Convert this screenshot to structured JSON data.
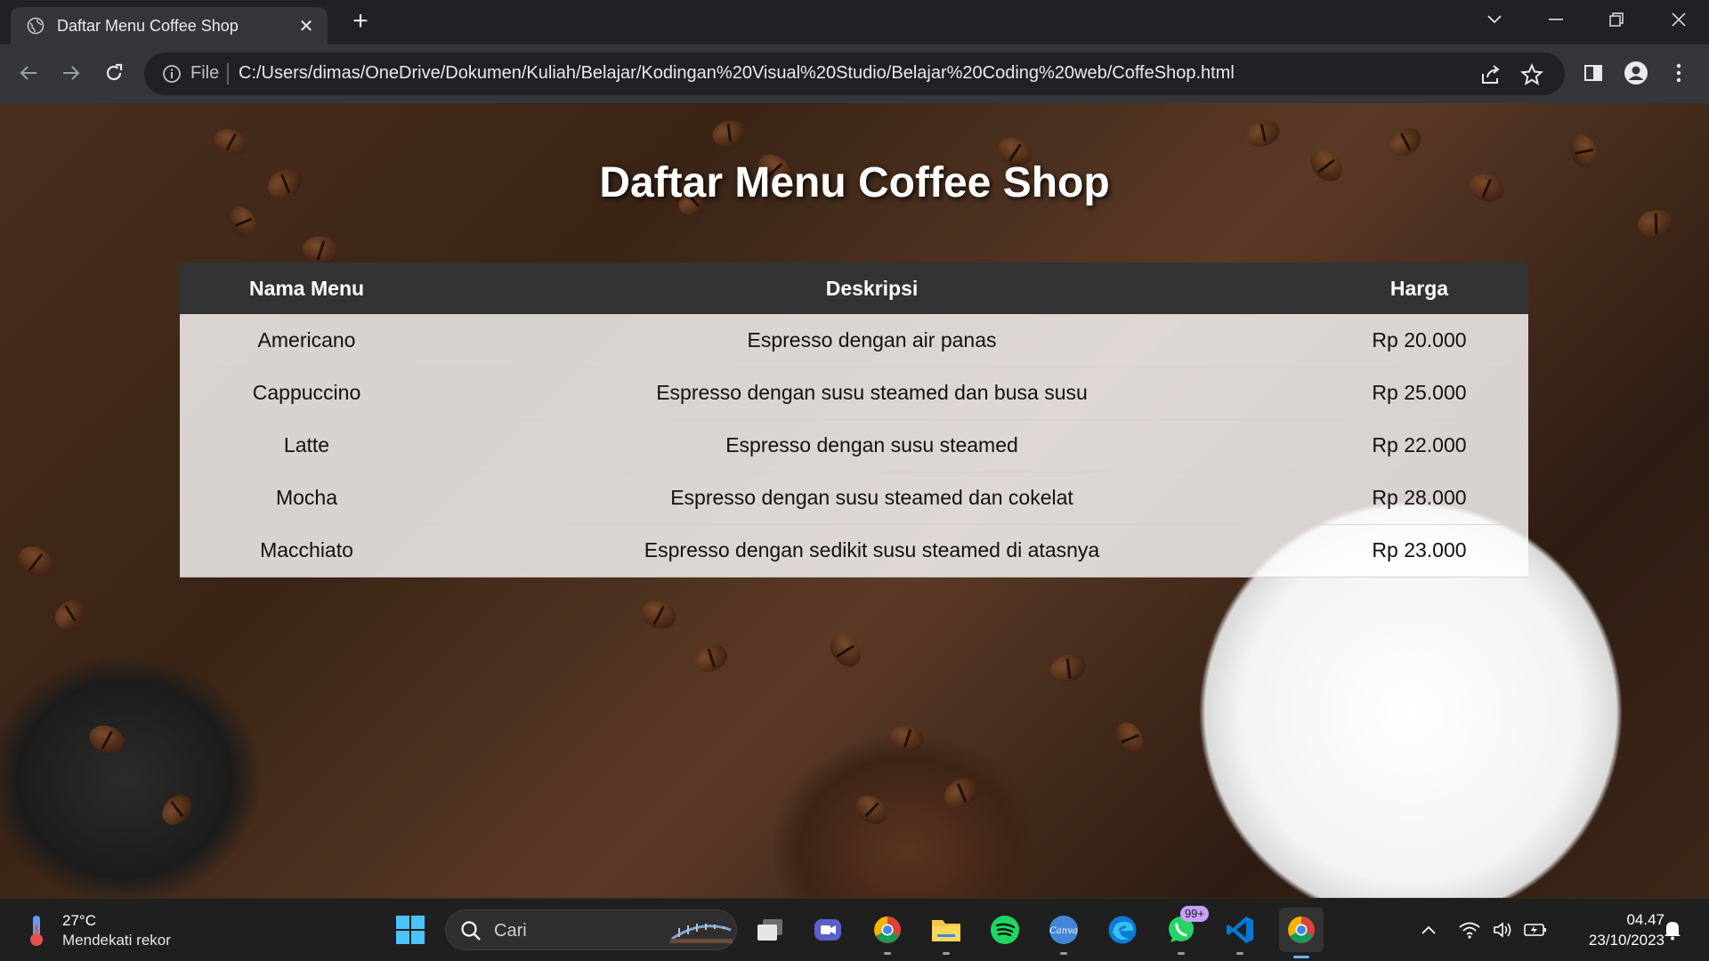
{
  "browser": {
    "tab_title": "Daftar Menu Coffee Shop",
    "address_scheme": "File",
    "address_url": "C:/Users/dimas/OneDrive/Dokumen/Kuliah/Belajar/Kodingan%20Visual%20Studio/Belajar%20Coding%20web/CoffeShop.html"
  },
  "page": {
    "title": "Daftar Menu Coffee Shop",
    "table": {
      "headers": [
        "Nama Menu",
        "Deskripsi",
        "Harga"
      ],
      "rows": [
        {
          "name": "Americano",
          "description": "Espresso dengan air panas",
          "price": "Rp 20.000"
        },
        {
          "name": "Cappuccino",
          "description": "Espresso dengan susu steamed dan busa susu",
          "price": "Rp 25.000"
        },
        {
          "name": "Latte",
          "description": "Espresso dengan susu steamed",
          "price": "Rp 22.000"
        },
        {
          "name": "Mocha",
          "description": "Espresso dengan susu steamed dan cokelat",
          "price": "Rp 28.000"
        },
        {
          "name": "Macchiato",
          "description": "Espresso dengan sedikit susu steamed di atasnya",
          "price": "Rp 23.000"
        }
      ]
    }
  },
  "taskbar": {
    "weather_temp": "27°C",
    "weather_condition": "Mendekati rekor",
    "search_placeholder": "Cari",
    "whatsapp_badge": "99+",
    "time": "04.47",
    "date": "23/10/2023"
  },
  "colors": {
    "header_bg": "#333333",
    "row_bg": "rgba(255,255,255,0.80)",
    "chrome_dark": "#202124",
    "chrome_toolbar": "#35363a"
  }
}
